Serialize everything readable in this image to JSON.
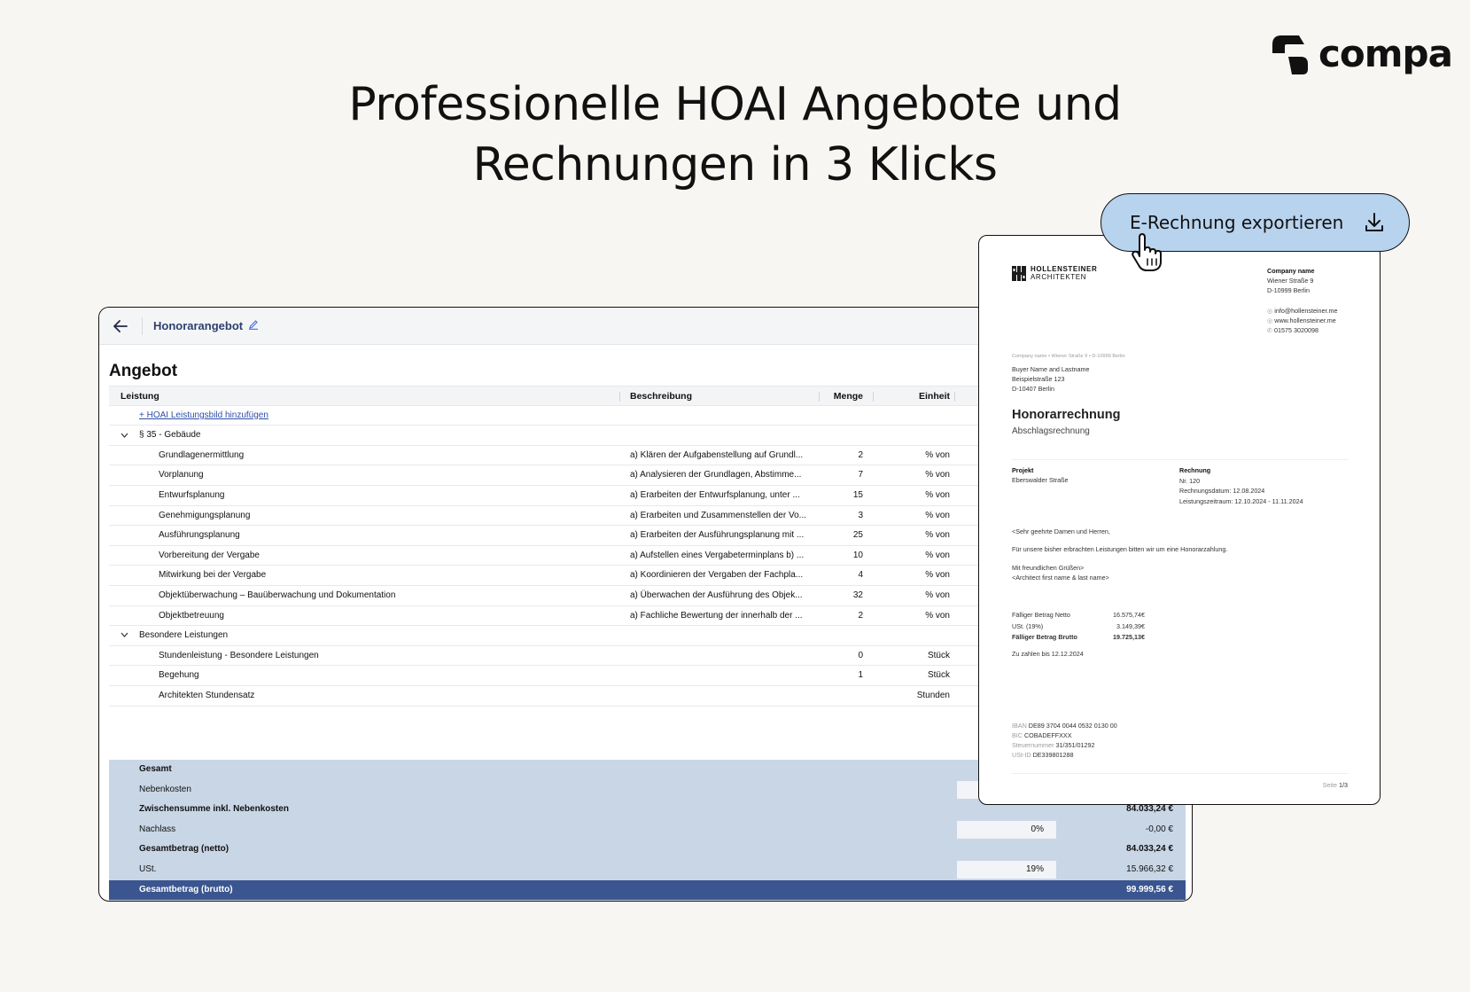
{
  "brand": {
    "name": "compa"
  },
  "headline": {
    "line1": "Professionelle HOAI Angebote und",
    "line2": "Rechnungen in 3 Klicks"
  },
  "app": {
    "doc_title": "Honorarangebot",
    "section_title": "Angebot",
    "columns": {
      "leistung": "Leistung",
      "beschreibung": "Beschreibung",
      "menge": "Menge",
      "einheit": "Einheit"
    },
    "add_link": "+ HOAI Leistungsbild hinzufügen",
    "groups": [
      {
        "title": "§ 35 - Gebäude",
        "rows": [
          {
            "leistung": "Grundlagenermittlung",
            "beschreibung": "a) Klären der Aufgabenstellung auf Grundl...",
            "menge": "2",
            "einheit": "% von"
          },
          {
            "leistung": "Vorplanung",
            "beschreibung": "a) Analysieren der Grundlagen, Abstimme...",
            "menge": "7",
            "einheit": "% von"
          },
          {
            "leistung": "Entwurfsplanung",
            "beschreibung": "a) Erarbeiten der Entwurfsplanung, unter ...",
            "menge": "15",
            "einheit": "% von"
          },
          {
            "leistung": "Genehmigungsplanung",
            "beschreibung": "a) Erarbeiten und Zusammenstellen der Vo...",
            "menge": "3",
            "einheit": "% von"
          },
          {
            "leistung": "Ausführungsplanung",
            "beschreibung": "a) Erarbeiten der Ausführungsplanung mit ...",
            "menge": "25",
            "einheit": "% von"
          },
          {
            "leistung": "Vorbereitung der Vergabe",
            "beschreibung": "a) Aufstellen eines Vergabeterminplans b) ...",
            "menge": "10",
            "einheit": "% von"
          },
          {
            "leistung": "Mitwirkung bei der Vergabe",
            "beschreibung": "a) Koordinieren der Vergaben der Fachpla...",
            "menge": "4",
            "einheit": "% von"
          },
          {
            "leistung": "Objektüberwachung – Bauüberwachung und Dokumentation",
            "beschreibung": "a) Überwachen der Ausführung des Objek...",
            "menge": "32",
            "einheit": "% von"
          },
          {
            "leistung": "Objektbetreuung",
            "beschreibung": "a) Fachliche Bewertung der innerhalb der ...",
            "menge": "2",
            "einheit": "% von"
          }
        ]
      },
      {
        "title": "Besondere Leistungen",
        "rows": [
          {
            "leistung": "Stundenleistung - Besondere Leistungen",
            "beschreibung": "",
            "menge": "0",
            "einheit": "Stück"
          },
          {
            "leistung": "Begehung",
            "beschreibung": "",
            "menge": "1",
            "einheit": "Stück"
          },
          {
            "leistung": "Architekten Stundensatz",
            "beschreibung": "",
            "menge": "",
            "einheit": "Stunden"
          }
        ]
      }
    ],
    "totals": [
      {
        "label": "Gesamt",
        "pct": "",
        "value": "",
        "bold": true
      },
      {
        "label": "Nebenkosten",
        "pct": "",
        "value": "",
        "bold": false
      },
      {
        "label": "Zwischensumme inkl. Nebenkosten",
        "pct": "",
        "value": "84.033,24 €",
        "bold": true
      },
      {
        "label": "Nachlass",
        "pct": "0%",
        "value": "-0,00 €",
        "bold": false
      },
      {
        "label": "Gesamtbetrag (netto)",
        "pct": "",
        "value": "84.033,24 €",
        "bold": true
      },
      {
        "label": "USt.",
        "pct": "19%",
        "value": "15.966,32 €",
        "bold": false
      },
      {
        "label": "Gesamtbetrag (brutto)",
        "pct": "",
        "value": "99.999,56 €",
        "bold": true
      }
    ]
  },
  "export_button": {
    "label": "E-Rechnung exportieren"
  },
  "invoice": {
    "logo_line1": "HOLLENSTEINER",
    "logo_line2": "ARCHITEKTEN",
    "company": {
      "name": "Company name",
      "street": "Wiener Straße 9",
      "city": "D-10999 Berlin",
      "email": "info@hollensteiner.me",
      "web": "www.hollensteiner.me",
      "phone": "01575 3020098"
    },
    "sender_line": "Company name • Wiener Straße 9 • D-10999 Berlin",
    "buyer": {
      "name": "Buyer Name and Lastname",
      "street": "Beispielstraße 123",
      "city": "D-10407 Berlin"
    },
    "title": "Honorarrechnung",
    "subtitle": "Abschlagsrechnung",
    "projekt_label": "Projekt",
    "projekt_value": "Eberswalder Straße",
    "rechnung_label": "Rechnung",
    "rechnung_nr": "Nr. 120",
    "rechnung_datum": "Rechnungsdatum: 12.08.2024",
    "leistungszeitraum": "Leistungszeitraum: 12.10.2024 - 11.11.2024",
    "greeting": "<Sehr geehrte Damen und Herren,",
    "body": "Für unsere bisher erbrachten Leistungen bitten wir um eine Honorarzahlung.",
    "closing": "Mit freundlichen Grüßen>",
    "signature": "<Architect first name & last name>",
    "amounts": [
      {
        "label": "Fälliger Betrag Netto",
        "value": "16.575,74€",
        "bold": false
      },
      {
        "label": "USt. (19%)",
        "value": "3.149,39€",
        "bold": false
      },
      {
        "label": "Fälliger Betrag Brutto",
        "value": "19.725,13€",
        "bold": true
      }
    ],
    "due": "Zu zahlen bis 12.12.2024",
    "bank": [
      {
        "label": "IBAN",
        "value": "DE89 3704 0044 0532 0130 00"
      },
      {
        "label": "BIC",
        "value": "COBADEFFXXX"
      },
      {
        "label": "Steuernummer",
        "value": "31/351/01292"
      },
      {
        "label": "USt-ID",
        "value": "DE339801288"
      }
    ],
    "page_label": "Seite",
    "page_value": "1/3"
  }
}
